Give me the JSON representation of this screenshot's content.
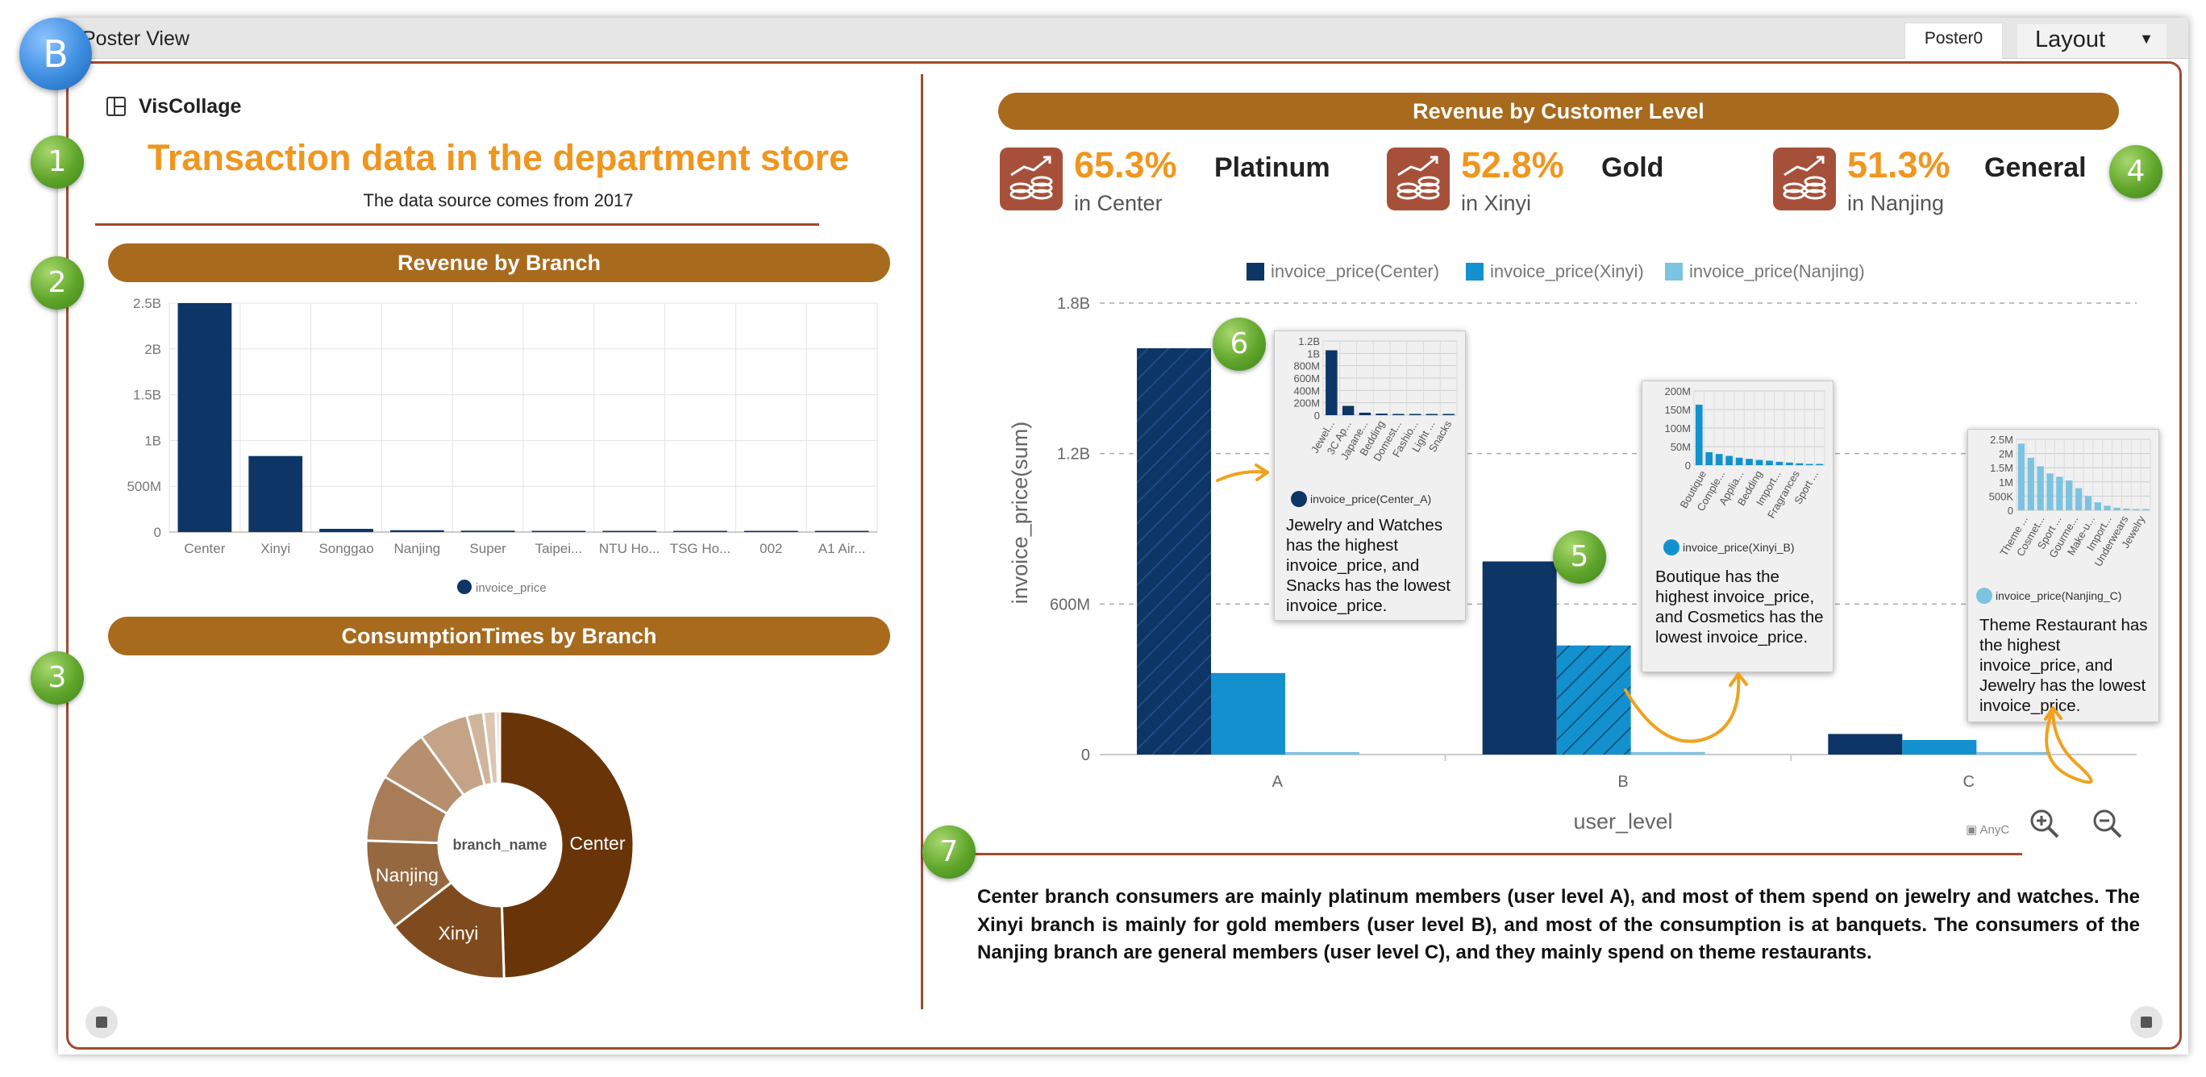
{
  "window": {
    "title": "Poster View",
    "tab_poster": "Poster0",
    "tab_layout": "Layout"
  },
  "badges": {
    "b": "B",
    "n1": "1",
    "n2": "2",
    "n3": "3",
    "n4": "4",
    "n5": "5",
    "n6": "6",
    "n7": "7"
  },
  "app": {
    "logo": "VisCollage"
  },
  "poster": {
    "title": "Transaction data in the department store",
    "subtitle": "The data source comes from 2017"
  },
  "sections": {
    "revenue_branch": "Revenue by Branch",
    "consumption_branch": "ConsumptionTimes by Branch",
    "revenue_level": "Revenue by Customer Level"
  },
  "kpis": [
    {
      "pct": "65.3%",
      "level": "Platinum",
      "loc": "in Center"
    },
    {
      "pct": "52.8%",
      "level": "Gold",
      "loc": "in Xinyi"
    },
    {
      "pct": "51.3%",
      "level": "General",
      "loc": "in Nanjing"
    }
  ],
  "colors": {
    "accent": "#f0961e",
    "border": "#a34a2e",
    "pill": "#a86a1d",
    "navy": "#0d3566",
    "blue": "#1391cf",
    "light": "#7cc3e0"
  },
  "icons": {
    "kpi": "revenue-coins-chart-icon",
    "zoom_in": "zoom-in-icon",
    "zoom_out": "zoom-out-icon",
    "play": "play-icon",
    "save": "save-icon",
    "layout_caret": "chevron-down-icon"
  },
  "narrative": "Center branch consumers are mainly platinum members (user level A), and most of them spend on jewelry and watches. The Xinyi branch is mainly for gold members (user level B), and most of the consumption is at banquets. The consumers of the Nanjing branch are general members (user level C), and they mainly spend on theme restaurants.",
  "credit": "AnyC",
  "chart_data": [
    {
      "type": "bar",
      "title": "Revenue by Branch",
      "categories": [
        "Center",
        "Xinyi",
        "Songgao",
        "Nanjing",
        "Super",
        "Taipei...",
        "NTU Ho...",
        "TSG Ho...",
        "002",
        "A1 Air..."
      ],
      "series": [
        {
          "name": "invoice_price",
          "values": [
            2500000000,
            830000000,
            35000000,
            20000000,
            15000000,
            8000000,
            2000000,
            1000000,
            500000,
            300000
          ]
        }
      ],
      "ylim": [
        0,
        2500000000
      ],
      "yticks": [
        "0",
        "500M",
        "1B",
        "1.5B",
        "2B",
        "2.5B"
      ],
      "grid": true,
      "legend": "bottom"
    },
    {
      "type": "pie",
      "title": "ConsumptionTimes by Branch",
      "center_label": "branch_name",
      "slices": [
        {
          "label": "Center",
          "value": 49.5
        },
        {
          "label": "Xinyi",
          "value": 15
        },
        {
          "label": "Nanjing",
          "value": 11
        },
        {
          "label": "",
          "value": 8
        },
        {
          "label": "",
          "value": 6.5
        },
        {
          "label": "",
          "value": 6
        },
        {
          "label": "",
          "value": 2
        },
        {
          "label": "",
          "value": 1.5
        },
        {
          "label": "",
          "value": 0.5
        }
      ]
    },
    {
      "type": "bar",
      "title": "Revenue by Customer Level",
      "categories": [
        "A",
        "B",
        "C"
      ],
      "xlabel": "user_level",
      "ylabel": "invoice_price(sum)",
      "series": [
        {
          "name": "invoice_price(Center)",
          "values": [
            1620000000,
            770000000,
            82000000
          ]
        },
        {
          "name": "invoice_price(Xinyi)",
          "values": [
            325000000,
            435000000,
            58000000
          ]
        },
        {
          "name": "invoice_price(Nanjing)",
          "values": [
            8000000,
            10000000,
            10000000
          ]
        }
      ],
      "ylim": [
        0,
        1800000000
      ],
      "yticks": [
        "0",
        "600M",
        "1.2B",
        "1.8B"
      ],
      "legend": "top"
    },
    {
      "type": "bar",
      "title": "",
      "legend": "invoice_price(Center_A)",
      "categories": [
        "Jewel...",
        "3C Ap...",
        "Japane...",
        "Bedding",
        "Domest...",
        "Fashio...",
        "Light ...",
        "Snacks"
      ],
      "values": [
        1050000000,
        150000000,
        40000000,
        25000000,
        12000000,
        6000000,
        3000000,
        1000000
      ],
      "yticks": [
        "0",
        "200M",
        "400M",
        "600M",
        "800M",
        "1B",
        "1.2B"
      ],
      "ylim": [
        0,
        1200000000
      ],
      "caption": "Jewelry and Watches has the highest invoice_price, and Snacks has the lowest invoice_price."
    },
    {
      "type": "bar",
      "title": "",
      "legend": "invoice_price(Xinyi_B)",
      "categories": [
        "Boutique",
        "Comple...",
        "Applia...",
        "Bedding",
        "Import...",
        "Fragrances",
        "Sport ..."
      ],
      "values": [
        163000000,
        35000000,
        30000000,
        25000000,
        20000000,
        17000000,
        14000000,
        12000000,
        9000000,
        7000000,
        5000000,
        3000000,
        2000000
      ],
      "yticks": [
        "0",
        "50M",
        "100M",
        "150M",
        "200M"
      ],
      "ylim": [
        0,
        200000000
      ],
      "caption": "Boutique has the highest invoice_price, and Cosmetics has the lowest invoice_price."
    },
    {
      "type": "bar",
      "title": "",
      "legend": "invoice_price(Nanjing_C)",
      "categories": [
        "Theme ...",
        "Cosmet...",
        "Sport ...",
        "Gourme...",
        "Make-u...",
        "Import...",
        "Underwears",
        "Jewelry"
      ],
      "values": [
        2350000,
        1850000,
        1550000,
        1300000,
        1180000,
        1050000,
        780000,
        500000,
        280000,
        160000,
        90000,
        60000,
        40000,
        30000
      ],
      "yticks": [
        "0",
        "500K",
        "1M",
        "1.5M",
        "2M",
        "2.5M"
      ],
      "ylim": [
        0,
        2500000
      ],
      "caption": "Theme Restaurant has the highest invoice_price, and Jewelry has the lowest invoice_price."
    }
  ]
}
